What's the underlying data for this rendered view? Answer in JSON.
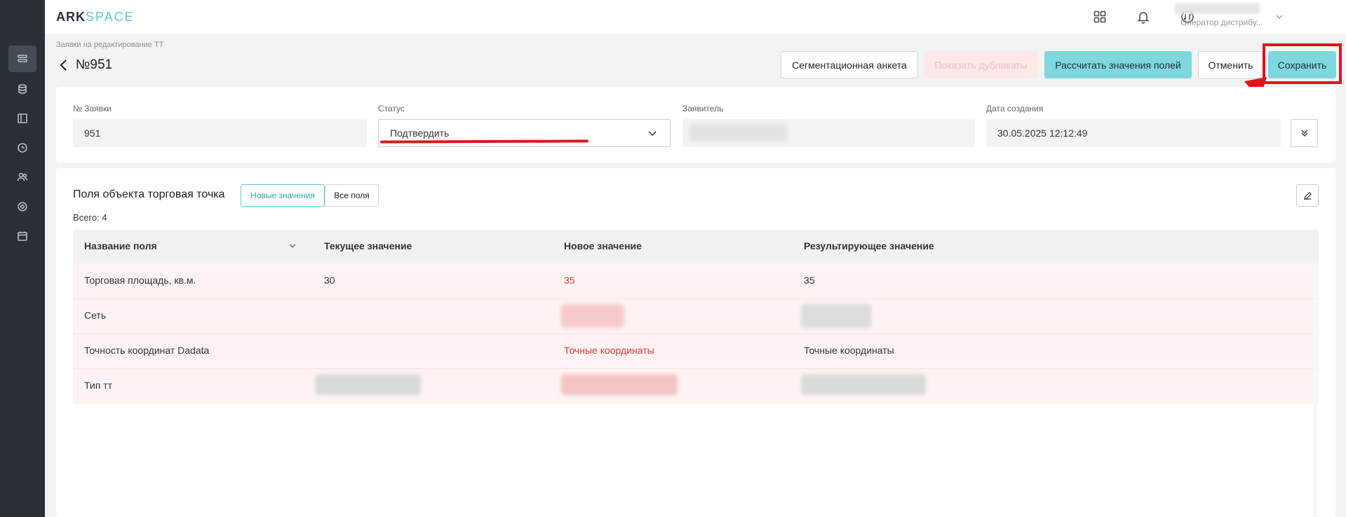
{
  "app": {
    "logo_part1": "ARK",
    "logo_part2": "SPACE",
    "user_role": "Оператор дистрибу..."
  },
  "sidebar": {
    "icons": [
      "list-icon",
      "database-icon",
      "book-icon",
      "clock-icon",
      "users-icon",
      "settings-icon",
      "calendar-icon"
    ]
  },
  "header": {
    "breadcrumb": "Заявки на редактирование ТТ",
    "title": "№951"
  },
  "toolbar": {
    "segmentation_label": "Сегментационная анкета",
    "duplicates_label": "Показать дубликаты",
    "calculate_label": "Рассчитать значения полей",
    "cancel_label": "Отменить",
    "save_label": "Сохранить"
  },
  "form": {
    "request_no_label": "№ Заявки",
    "request_no_value": "951",
    "status_label": "Статус",
    "status_value": "Подтвердить",
    "applicant_label": "Заявитель",
    "created_label": "Дата создания",
    "created_value": "30.05.2025 12:12:49"
  },
  "fields_section": {
    "title": "Поля объекта торговая точка",
    "tab_new": "Новые значения",
    "tab_all": "Все поля",
    "total": "Всего: 4",
    "columns": [
      "Название поля",
      "Текущее значение",
      "Новое значение",
      "Результирующее значение"
    ],
    "rows": [
      {
        "name": "Торговая площадь, кв.м.",
        "current": "30",
        "new": "35",
        "result": "35"
      },
      {
        "name": "Сеть",
        "current": "",
        "new": "",
        "result": ""
      },
      {
        "name": "Точность координат Dadata",
        "current": "",
        "new": "Точные координаты",
        "result": "Точные координаты"
      },
      {
        "name": "Тип тт",
        "current": "",
        "new": "",
        "result": ""
      }
    ]
  },
  "colors": {
    "accent": "#5ec7cf",
    "sidebar_bg": "#2b2f36",
    "teal_button": "#7fd8dd",
    "highlight_red": "#e5121b",
    "row_bg": "#fef3f3",
    "new_value_text": "#d33a3a"
  }
}
